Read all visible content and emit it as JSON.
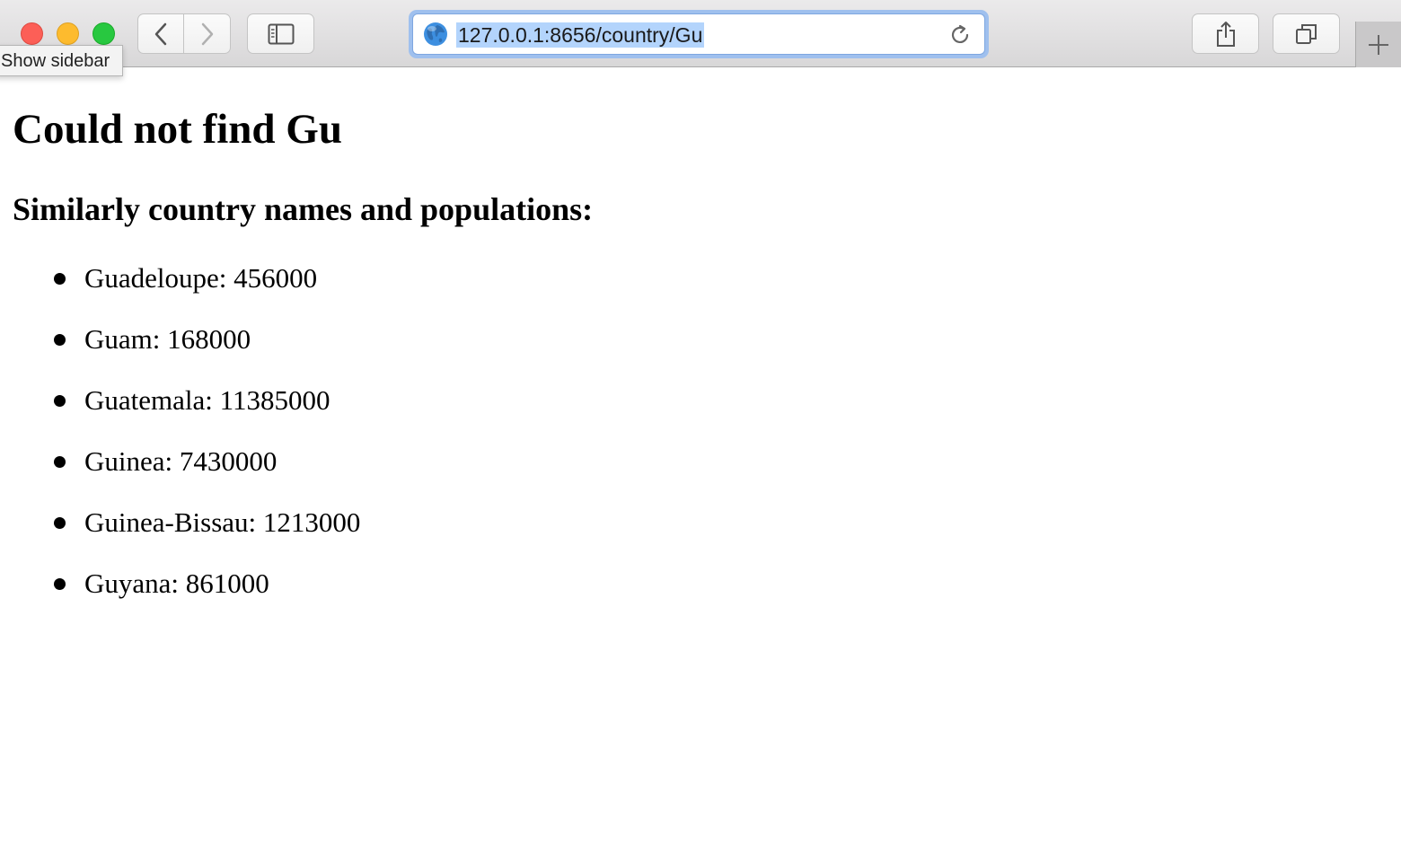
{
  "browser": {
    "url": "127.0.0.1:8656/country/Gu",
    "tooltip": "Show sidebar",
    "icons": {
      "close": "close-dot",
      "minimize": "minimize-dot",
      "maximize": "maximize-dot",
      "back": "chevron-left-icon",
      "forward": "chevron-right-icon",
      "sidebar": "sidebar-icon",
      "globe": "globe-icon",
      "reload": "reload-icon",
      "share": "share-icon",
      "tabs": "tabs-overview-icon",
      "new_tab": "plus-icon"
    },
    "colors": {
      "close": "#fc5f57",
      "minimize": "#fdbb2e",
      "maximize": "#28c840",
      "url_highlight": "#b3d4fc",
      "focus_ring": "#9fc0ee"
    }
  },
  "page": {
    "title": "Could not find Gu",
    "subtitle": "Similarly country names and populations:",
    "countries": [
      {
        "name": "Guadeloupe",
        "population": "456000"
      },
      {
        "name": "Guam",
        "population": "168000"
      },
      {
        "name": "Guatemala",
        "population": "11385000"
      },
      {
        "name": "Guinea",
        "population": "7430000"
      },
      {
        "name": "Guinea-Bissau",
        "population": "1213000"
      },
      {
        "name": "Guyana",
        "population": "861000"
      }
    ]
  }
}
